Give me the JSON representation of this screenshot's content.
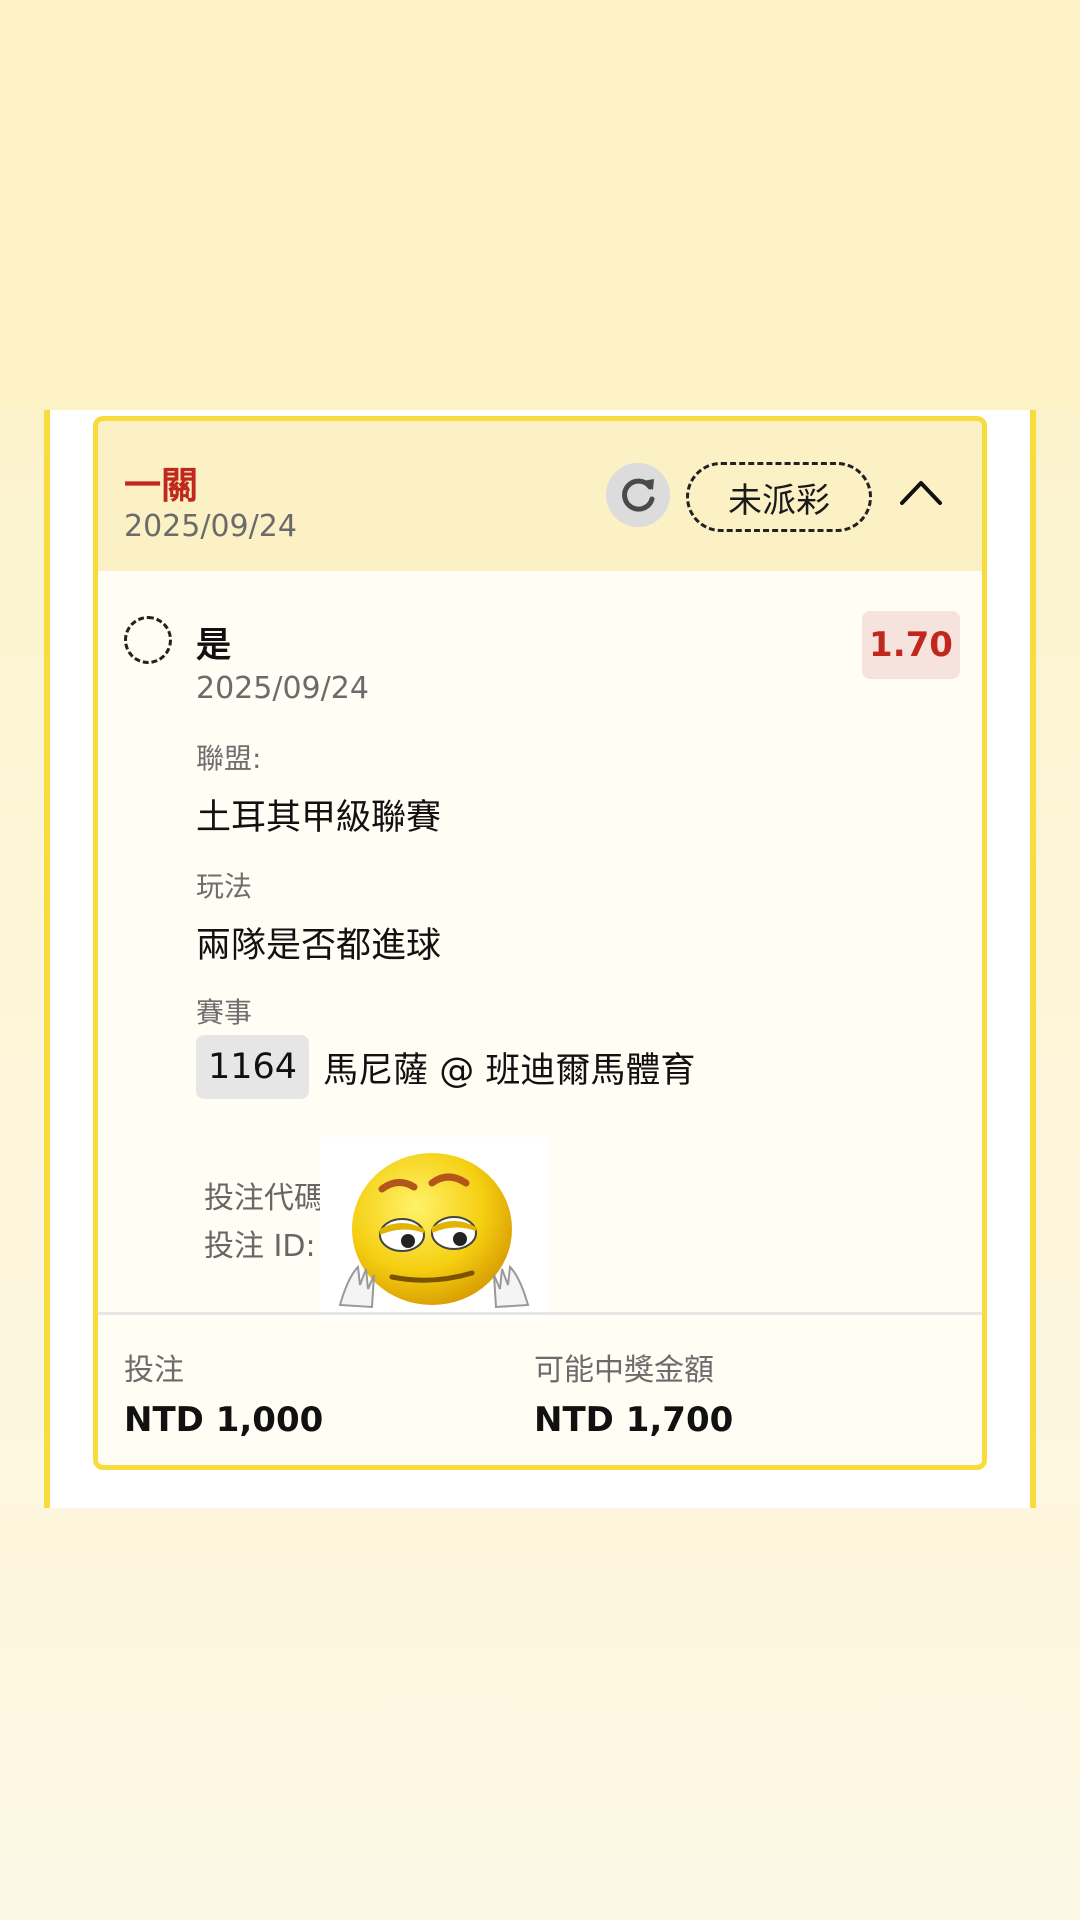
{
  "header": {
    "bet_type": "一關",
    "date": "2025/09/24",
    "status": "未派彩"
  },
  "selection": {
    "name": "是",
    "date": "2025/09/24",
    "odds": "1.70",
    "league_label": "聯盟:",
    "league": "土耳其甲級聯賽",
    "market_label": "玩法",
    "market": "兩隊是否都進球",
    "event_label": "賽事",
    "event_number": "1164",
    "event_name": "馬尼薩 @ 班迪爾馬體育"
  },
  "bet_info": {
    "code_label": "投注代碼",
    "id_label": "投注 ID:"
  },
  "footer": {
    "stake_label": "投注",
    "stake_value": "NTD 1,000",
    "payout_label": "可能中獎金額",
    "payout_value": "NTD 1,700"
  },
  "icons": {
    "refresh": "refresh-icon",
    "collapse": "chevron-up-icon",
    "emoji": "sad-emoji-sticker"
  },
  "colors": {
    "accent_red": "#c0281e",
    "border_yellow": "#f8dc3d",
    "header_bg": "#fcf1c4"
  }
}
